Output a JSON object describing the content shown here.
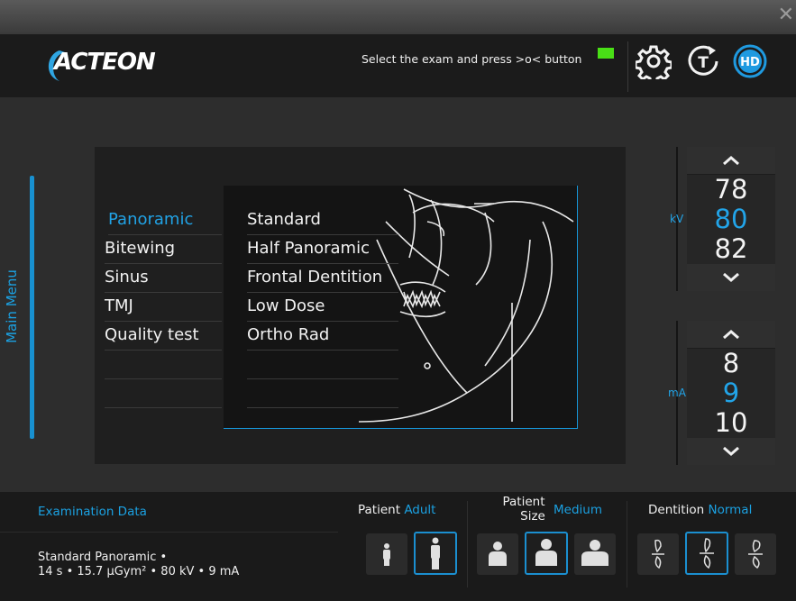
{
  "titlebar": {
    "close_glyph": "✕"
  },
  "header": {
    "logo_text": "ACTEON",
    "instruction": "Select the exam and press >o< button",
    "status_led_color": "#49e016",
    "buttons": [
      {
        "name": "settings",
        "icon": "gear-icon"
      },
      {
        "name": "test",
        "icon": "timer-t-icon",
        "glyph": "T"
      },
      {
        "name": "hd",
        "icon": "hd-icon",
        "glyph": "HD"
      }
    ]
  },
  "sidebar": {
    "label": "Main Menu"
  },
  "exam_types": [
    {
      "label": "Panoramic",
      "selected": true
    },
    {
      "label": "Bitewing",
      "selected": false
    },
    {
      "label": "Sinus",
      "selected": false
    },
    {
      "label": "TMJ",
      "selected": false
    },
    {
      "label": "Quality test",
      "selected": false
    }
  ],
  "exam_programs": [
    {
      "label": "Standard",
      "selected": false
    },
    {
      "label": "Half Panoramic",
      "selected": false
    },
    {
      "label": "Frontal Dentition",
      "selected": false
    },
    {
      "label": "Low Dose",
      "selected": false
    },
    {
      "label": "Ortho Rad",
      "selected": false
    }
  ],
  "kv": {
    "unit": "kV",
    "prev": "78",
    "current": "80",
    "next": "82"
  },
  "ma": {
    "unit": "mA",
    "prev": "8",
    "current": "9",
    "next": "10"
  },
  "exam_data": {
    "title": "Examination Data",
    "line1": "Standard Panoramic •",
    "line2": "14 s • 15.7 µGym² • 80 kV • 9 mA"
  },
  "patient": {
    "label": "Patient",
    "value": "Adult"
  },
  "patient_size": {
    "label_line1": "Patient",
    "label_line2": "Size",
    "value": "Medium"
  },
  "dentition": {
    "label": "Dentition",
    "value": "Normal"
  },
  "accent_color": "#1ba1e2"
}
